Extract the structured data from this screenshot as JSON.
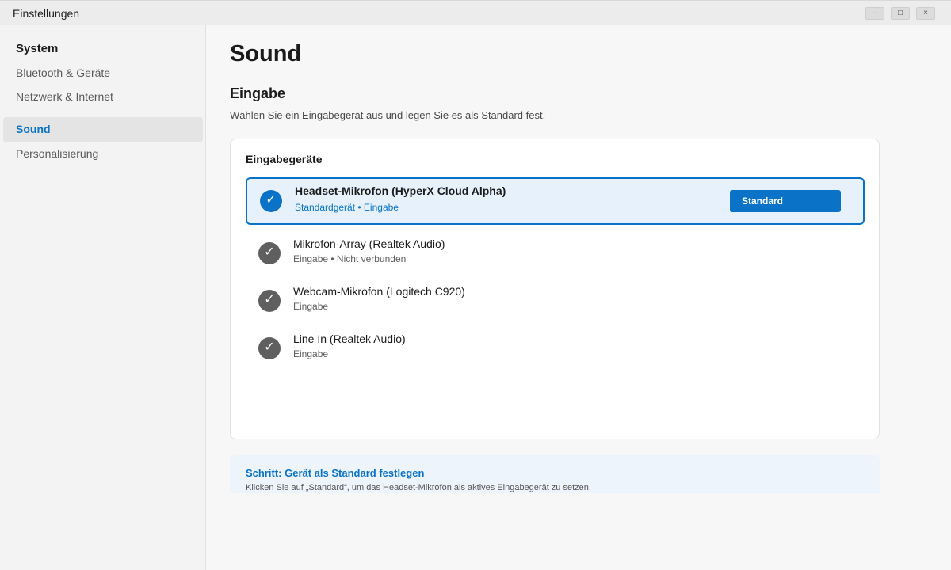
{
  "window": {
    "title": "Einstellungen",
    "minimize": "–",
    "maximize": "□",
    "close": "×"
  },
  "sidebar": {
    "items": [
      {
        "label": "System"
      },
      {
        "label": "Bluetooth & Geräte"
      },
      {
        "label": "Netzwerk & Internet"
      },
      {
        "label": "Sound"
      },
      {
        "label": "Personalisierung"
      }
    ]
  },
  "main": {
    "page_title": "Sound",
    "section_title": "Eingabe",
    "section_desc": "Wählen Sie ein Eingabegerät aus und legen Sie es als Standard fest.",
    "card_title": "Eingabegeräte",
    "devices": [
      {
        "name": "Headset-Mikrofon (HyperX Cloud Alpha)",
        "sub": "Standardgerät • Eingabe",
        "button": "Standard"
      },
      {
        "name": "Mikrofon-Array (Realtek Audio)",
        "sub": "Eingabe • Nicht verbunden"
      },
      {
        "name": "Webcam-Mikrofon (Logitech C920)",
        "sub": "Eingabe"
      },
      {
        "name": "Line In (Realtek Audio)",
        "sub": "Eingabe"
      }
    ],
    "hint_title": "Schritt: Gerät als Standard festlegen",
    "hint_text": "Klicken Sie auf „Standard“, um das Headset-Mikrofon als aktives Eingabegerät zu setzen."
  },
  "icons": {
    "check": "✓"
  },
  "colors": {
    "accent": "#0a73c8",
    "check_inactive": "#5f5f5f",
    "selected_bg": "#e6f1fb"
  }
}
